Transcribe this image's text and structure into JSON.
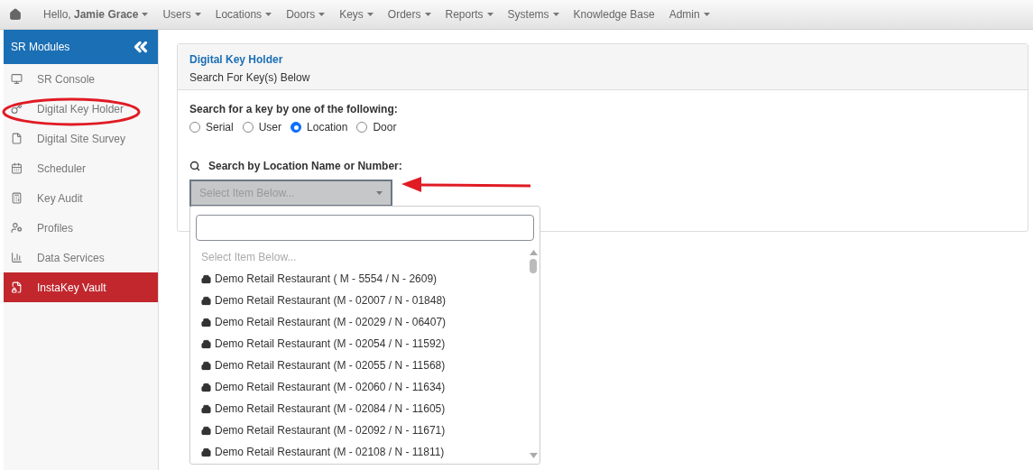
{
  "navbar": {
    "items": [
      {
        "label": "Hello, **Jamie Grace**",
        "dropdown": true
      },
      {
        "label": "Users",
        "dropdown": true
      },
      {
        "label": "Locations",
        "dropdown": true
      },
      {
        "label": "Doors",
        "dropdown": true
      },
      {
        "label": "Keys",
        "dropdown": true
      },
      {
        "label": "Orders",
        "dropdown": true
      },
      {
        "label": "Reports",
        "dropdown": true
      },
      {
        "label": "Systems",
        "dropdown": true
      },
      {
        "label": "Knowledge Base",
        "dropdown": false
      },
      {
        "label": "Admin",
        "dropdown": true
      }
    ]
  },
  "sidebar": {
    "title": "SR Modules",
    "items": [
      {
        "label": "SR Console",
        "selected": false
      },
      {
        "label": "Digital Key Holder",
        "selected": false
      },
      {
        "label": "Digital Site Survey",
        "selected": false
      },
      {
        "label": "Scheduler",
        "selected": false
      },
      {
        "label": "Key Audit",
        "selected": false
      },
      {
        "label": "Profiles",
        "selected": false
      },
      {
        "label": "Data Services",
        "selected": false
      },
      {
        "label": "InstaKey Vault",
        "selected": true
      }
    ]
  },
  "panel": {
    "title": "Digital Key Holder",
    "subtitle": "Search For Key(s) Below",
    "search_prompt": "Search for a key by one of the following:",
    "options": [
      {
        "label": "Serial",
        "selected": false
      },
      {
        "label": "User",
        "selected": false
      },
      {
        "label": "Location",
        "selected": true
      },
      {
        "label": "Door",
        "selected": false
      }
    ],
    "search_label": "Search by Location Name or Number:",
    "select": {
      "placeholder": "Select Item Below...",
      "disabled": true
    }
  },
  "dropdown": {
    "placeholder_option": "Select Item Below...",
    "options": [
      "Demo Retail Restaurant ( M - 5554 / N - 2609)",
      "Demo Retail Restaurant (M - 02007 / N - 01848)",
      "Demo Retail Restaurant (M - 02029 / N - 06407)",
      "Demo Retail Restaurant (M - 02054 / N - 11592)",
      "Demo Retail Restaurant (M - 02055 / N - 11568)",
      "Demo Retail Restaurant (M - 02060 / N - 11634)",
      "Demo Retail Restaurant (M - 02084 / N - 11605)",
      "Demo Retail Restaurant (M - 02092 / N - 11671)",
      "Demo Retail Restaurant (M - 02108 / N - 11811)"
    ]
  }
}
